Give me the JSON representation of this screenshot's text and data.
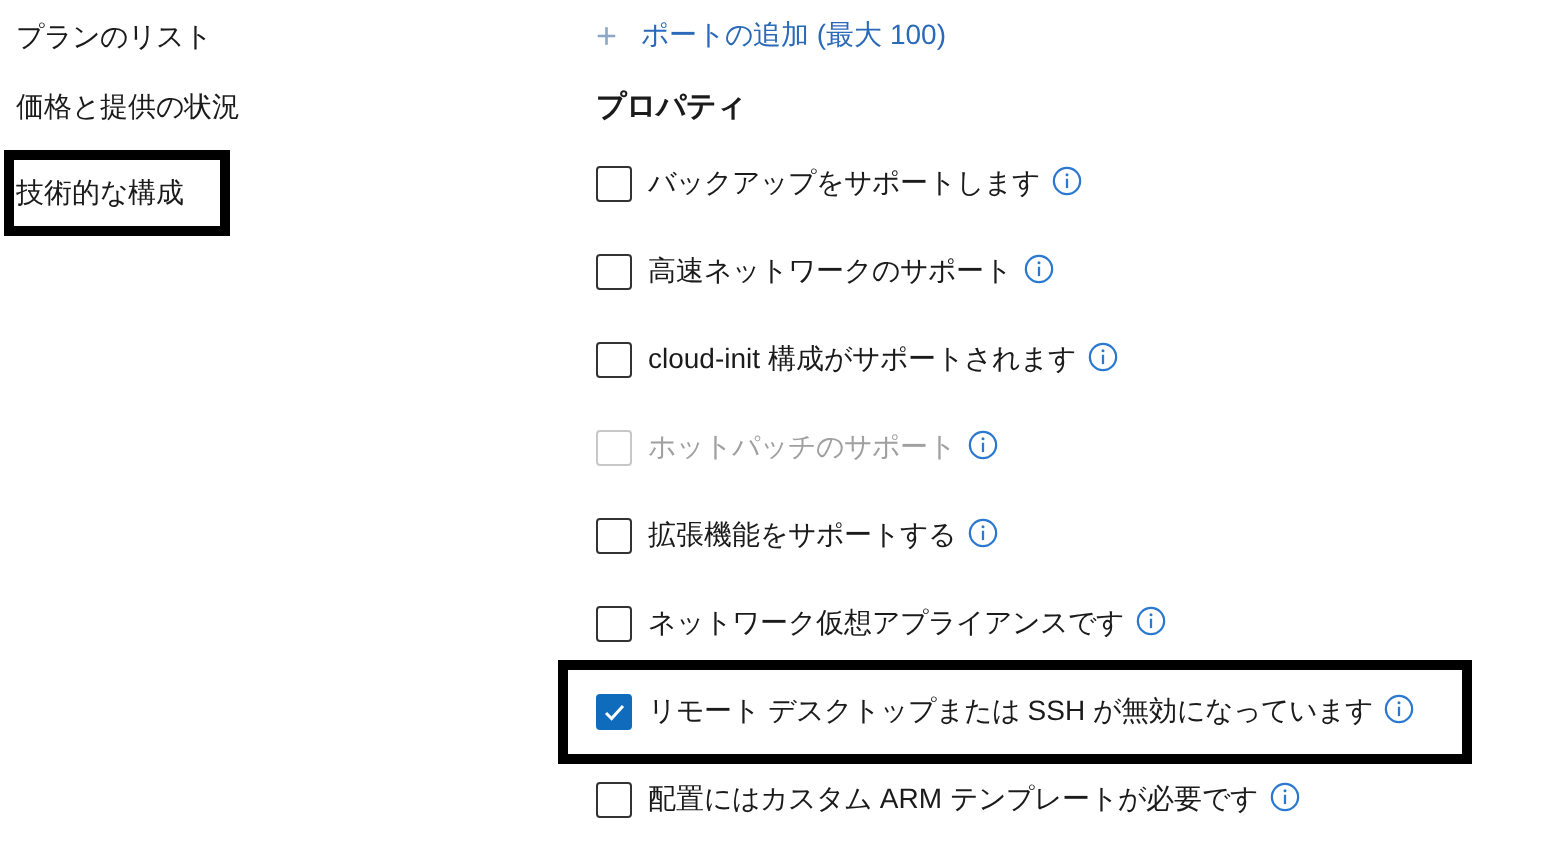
{
  "nav": {
    "items": [
      {
        "label": "プランのリスト",
        "highlighted": false
      },
      {
        "label": "価格と提供の状況",
        "highlighted": false
      },
      {
        "label": "技術的な構成",
        "highlighted": true
      }
    ]
  },
  "add_port": {
    "icon": "+",
    "label": "ポートの追加 (最大 100)"
  },
  "properties": {
    "heading": "プロパティ",
    "items": [
      {
        "label": "バックアップをサポートします",
        "checked": false,
        "disabled": false,
        "highlighted": false
      },
      {
        "label": "高速ネットワークのサポート",
        "checked": false,
        "disabled": false,
        "highlighted": false
      },
      {
        "label": "cloud-init 構成がサポートされます",
        "checked": false,
        "disabled": false,
        "highlighted": false
      },
      {
        "label": "ホットパッチのサポート",
        "checked": false,
        "disabled": true,
        "highlighted": false
      },
      {
        "label": "拡張機能をサポートする",
        "checked": false,
        "disabled": false,
        "highlighted": false
      },
      {
        "label": "ネットワーク仮想アプライアンスです",
        "checked": false,
        "disabled": false,
        "highlighted": false
      },
      {
        "label": "リモート デスクトップまたは SSH が無効になっています",
        "checked": true,
        "disabled": false,
        "highlighted": true
      },
      {
        "label": "配置にはカスタム ARM テンプレートが必要です",
        "checked": false,
        "disabled": false,
        "highlighted": false
      }
    ]
  }
}
